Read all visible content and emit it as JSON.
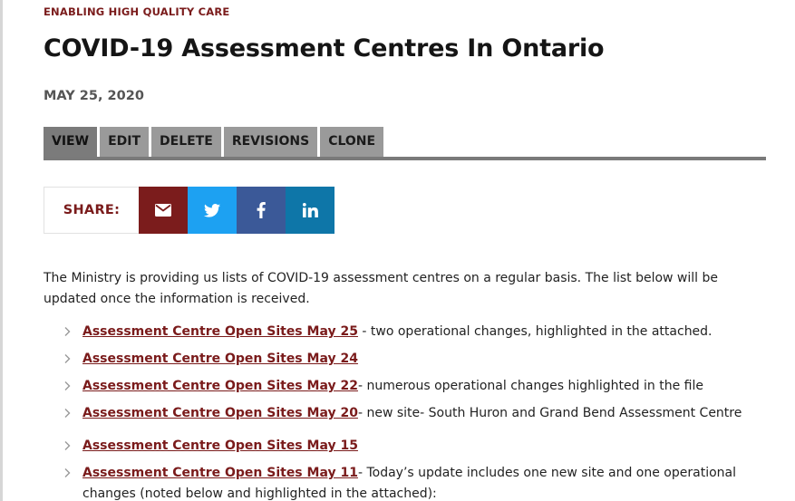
{
  "header": {
    "eyebrow": "ENABLING HIGH QUALITY CARE",
    "title": "COVID-19 Assessment Centres In Ontario",
    "date": "MAY 25, 2020"
  },
  "tabs": [
    {
      "label": "VIEW",
      "active": true
    },
    {
      "label": "EDIT",
      "active": false
    },
    {
      "label": "DELETE",
      "active": false
    },
    {
      "label": "REVISIONS",
      "active": false
    },
    {
      "label": "CLONE",
      "active": false
    }
  ],
  "share": {
    "label": "SHARE:",
    "buttons": [
      {
        "icon": "email-icon",
        "color": "#7b1c1c"
      },
      {
        "icon": "twitter-icon",
        "color": "#1da1f2"
      },
      {
        "icon": "facebook-icon",
        "color": "#3b5998"
      },
      {
        "icon": "linkedin-icon",
        "color": "#0e76a8"
      }
    ]
  },
  "content": {
    "intro": "The Ministry is providing us lists of COVID-19 assessment centres on a regular basis. The list below will be updated once the information is received.",
    "items": [
      {
        "link": "Assessment Centre Open Sites May 25",
        "note": " - two operational changes, highlighted in the attached."
      },
      {
        "link": "Assessment Centre Open Sites May 24",
        "note": ""
      },
      {
        "link": "Assessment Centre Open Sites May 22",
        "note": "- numerous operational changes highlighted in the file"
      },
      {
        "link": "Assessment Centre Open Sites May 20",
        "note": "- new site- South Huron and Grand Bend Assessment Centre"
      },
      {
        "link": "Assessment Centre Open Sites May 15",
        "note": ""
      },
      {
        "link": "Assessment Centre Open Sites May 11",
        "note": "- Today’s update includes one new site and one operational changes (noted below and highlighted in the attached):"
      }
    ]
  },
  "colors": {
    "accent": "#7a1b1b",
    "tab_bg": "#9a9a9a",
    "tab_active_bg": "#7b7b7b",
    "tab_rule": "#7a7a7a"
  }
}
